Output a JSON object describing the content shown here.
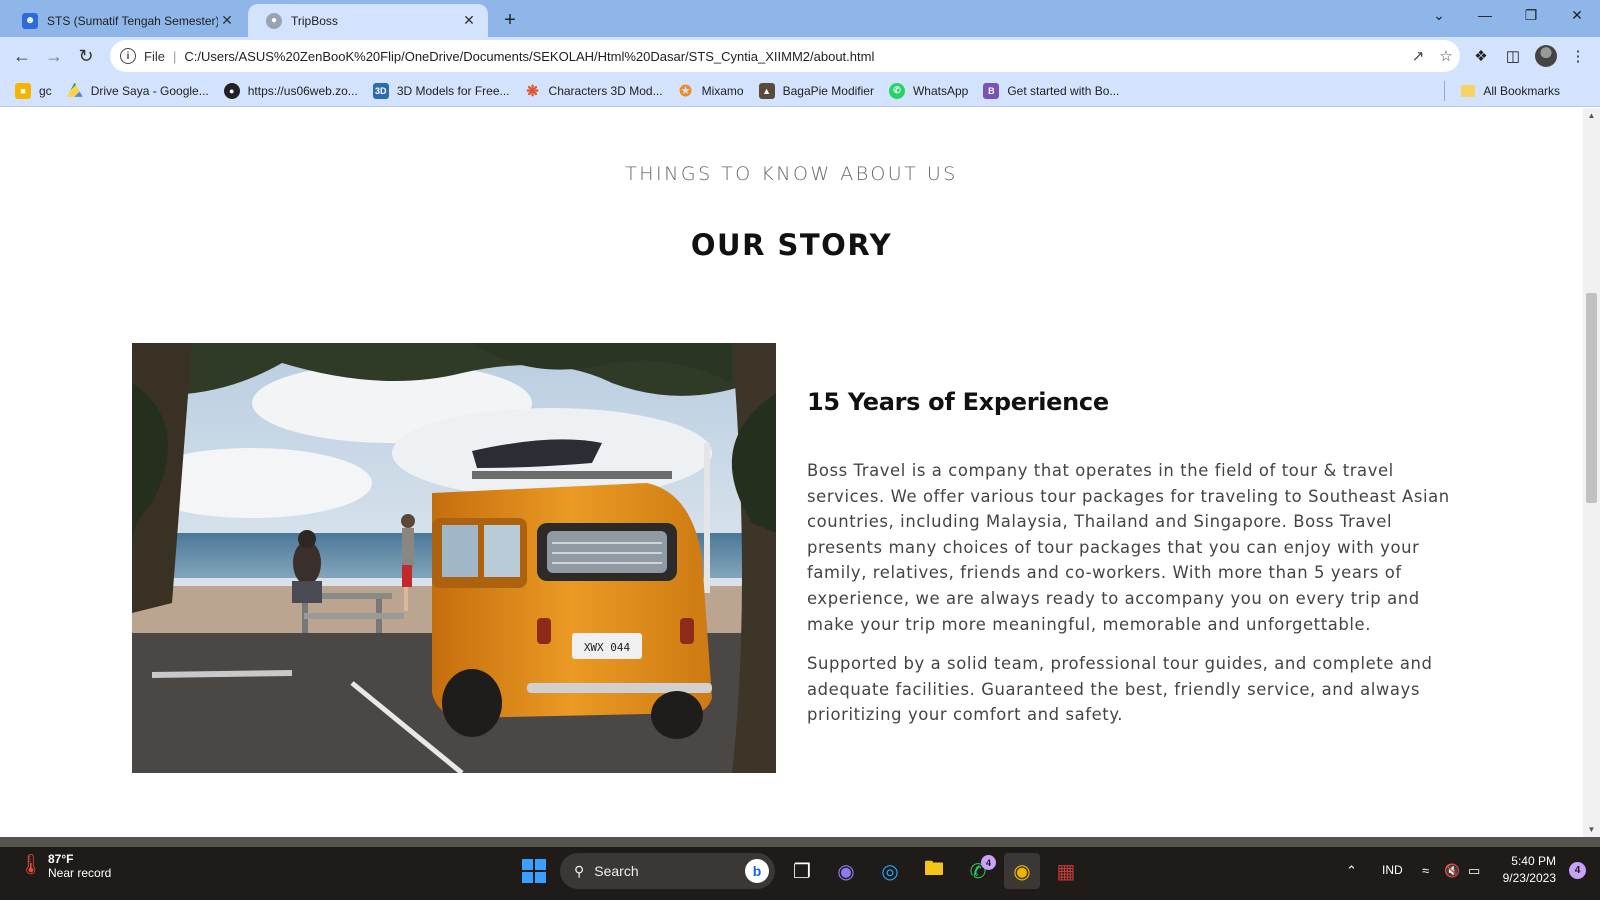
{
  "browser": {
    "tabs": [
      {
        "title": "STS (Sumatif Tengah Semester) C",
        "favicon": "person-icon",
        "active": false
      },
      {
        "title": "TripBoss",
        "favicon": "globe-icon",
        "active": true
      }
    ],
    "address": {
      "scheme_label": "File",
      "url": "C:/Users/ASUS%20ZenBooK%20Flip/OneDrive/Documents/SEKOLAH/Html%20Dasar/STS_Cyntia_XIIMM2/about.html"
    },
    "bookmarks": [
      {
        "label": "gc",
        "icon": "classroom-icon",
        "color": "#f4b400"
      },
      {
        "label": "Drive Saya - Google...",
        "icon": "drive-icon",
        "color": "#1fa463"
      },
      {
        "label": "https://us06web.zo...",
        "icon": "globe-icon",
        "color": "#222222"
      },
      {
        "label": "3D Models for Free...",
        "icon": "3d-icon",
        "color": "#2b6cb0"
      },
      {
        "label": "Characters 3D Mod...",
        "icon": "pinwheel-icon",
        "color": "#e0542b"
      },
      {
        "label": "Mixamo",
        "icon": "mixamo-icon",
        "color": "#f08a24"
      },
      {
        "label": "BagaPie Modifier",
        "icon": "bagapie-icon",
        "color": "#5a4a3a"
      },
      {
        "label": "WhatsApp",
        "icon": "whatsapp-icon",
        "color": "#25d366"
      },
      {
        "label": "Get started with Bo...",
        "icon": "bootstrap-icon",
        "color": "#7952b3"
      }
    ],
    "all_bookmarks_label": "All Bookmarks"
  },
  "page": {
    "eyebrow": "THINGS TO KNOW ABOUT US",
    "title": "OUR STORY",
    "subtitle": "15 Years of Experience",
    "paragraphs": [
      "Boss Travel is a company that operates in the field of tour & travel services. We offer various tour packages for traveling to Southeast Asian countries, including Malaysia, Thailand and Singapore. Boss Travel presents many choices of tour packages that you can enjoy with your family, relatives, friends and co-workers. With more than 5 years of experience, we are always ready to accompany you on every trip and make your trip more meaningful, memorable and unforgettable.",
      "Supported by a solid team, professional tour guides, and complete and adequate facilities. Guaranteed the best, friendly service, and always prioritizing your comfort and safety."
    ],
    "photo": {
      "plate": "XWX 044",
      "van_color": "#e8901a"
    }
  },
  "taskbar": {
    "weather": {
      "temp": "87°F",
      "desc": "Near record"
    },
    "search_label": "Search",
    "whatsapp_badge": "4",
    "tray": {
      "language": "IND"
    },
    "clock": {
      "time": "5:40 PM",
      "date": "9/23/2023"
    },
    "notifications": "4"
  }
}
